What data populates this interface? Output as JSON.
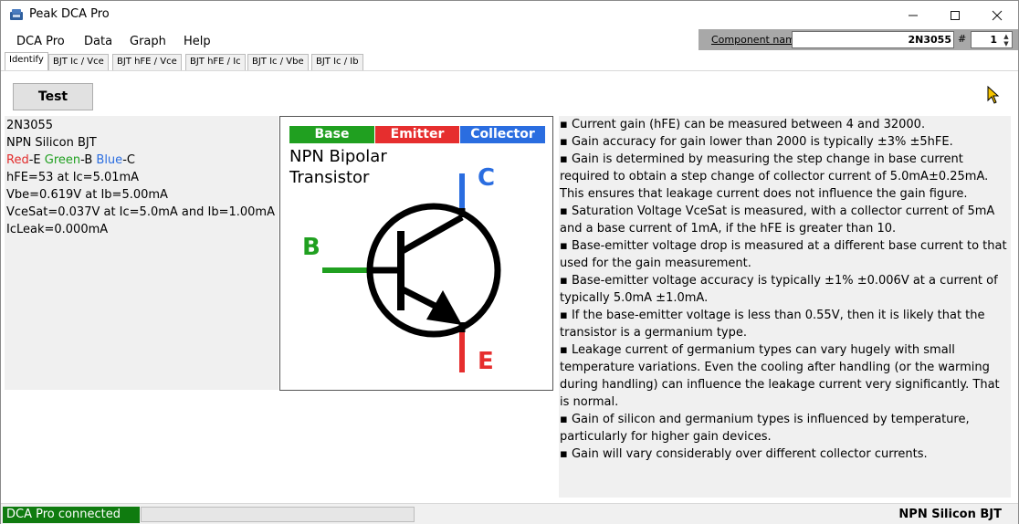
{
  "window": {
    "title": "Peak DCA Pro",
    "controls": {
      "minimize": "—",
      "maximize": "☐",
      "close": "✕"
    }
  },
  "menu": [
    "DCA Pro",
    "Data",
    "Graph",
    "Help"
  ],
  "component": {
    "label": "Component name",
    "value": "2N3055",
    "hash_label": "#",
    "number": "1"
  },
  "tabs": [
    "Identify",
    "BJT Ic / Vce",
    "BJT hFE / Vce",
    "BJT hFE / Ic",
    "BJT Ic / Vbe",
    "BJT Ic / Ib"
  ],
  "active_tab": "Identify",
  "test_button": "Test",
  "info": {
    "part": "2N3055",
    "type": "NPN Silicon BJT",
    "pinout": {
      "red": "Red",
      "red_pin": "-E ",
      "green": "Green",
      "green_pin": "-B ",
      "blue": "Blue",
      "blue_pin": "-C"
    },
    "hfe": "hFE=53 at Ic=5.01mA",
    "vbe": "Vbe=0.619V at Ib=5.00mA",
    "vcesat": "VceSat=0.037V at Ic=5.0mA and Ib=1.00mA",
    "icleak": "IcLeak=0.000mA"
  },
  "diagram": {
    "headers": {
      "base": "Base",
      "emitter": "Emitter",
      "collector": "Collector"
    },
    "title_line1": "NPN Bipolar",
    "title_line2": "Transistor",
    "pin_b": "B",
    "pin_c": "C",
    "pin_e": "E",
    "colors": {
      "base": "#20a020",
      "emitter": "#e62e2e",
      "collector": "#2a6de0"
    }
  },
  "notes": [
    "▪ Current gain (hFE) can be measured between 4 and 32000.",
    "▪ Gain accuracy for gain lower than 2000 is typically ±3% ±5hFE.",
    "▪ Gain is determined by measuring the step change in base current",
    "required to obtain a step change of collector current of 5.0mA±0.25mA.",
    "This ensures that leakage current does not influence the gain figure.",
    "▪ Saturation Voltage VceSat is measured, with a collector current of 5mA",
    "and a base current of 1mA, if the hFE is greater than 10.",
    "▪ Base-emitter voltage drop is measured at a different base current to that",
    "used for the gain measurement.",
    "▪ Base-emitter voltage accuracy is typically ±1% ±0.006V at a current of",
    "typically 5.0mA ±1.0mA.",
    "▪ If the base-emitter voltage is less than 0.55V, then it is likely that the",
    "transistor is a germanium type.",
    "▪ Leakage current of germanium types can vary hugely with small",
    "temperature variations. Even the cooling after handling (or the warming",
    "during handling) can influence the leakage current very significantly. That",
    "is normal.",
    "▪ Gain of silicon and germanium types is influenced by temperature,",
    "particularly for higher gain devices.",
    "▪ Gain will vary considerably over different collector currents."
  ],
  "status": {
    "connection": "DCA Pro connected",
    "device": "NPN Silicon BJT"
  }
}
